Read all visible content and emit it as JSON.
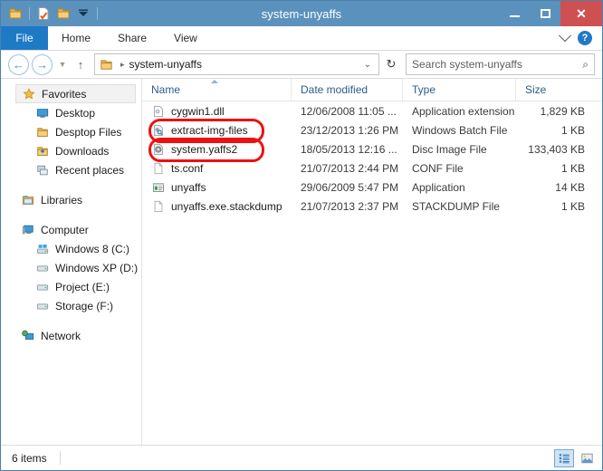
{
  "window": {
    "title": "system-unyaffs",
    "minimize_label": "–",
    "maximize_label": "☐",
    "close_label": "✕"
  },
  "quick_access": [
    {
      "name": "folder-icon",
      "label": "Folder"
    },
    {
      "name": "properties-icon",
      "label": "Properties"
    },
    {
      "name": "new-folder-icon",
      "label": "New folder"
    },
    {
      "name": "customize-dropdown-icon",
      "label": "Customize Quick Access Toolbar"
    }
  ],
  "ribbon": {
    "file_tab": "File",
    "tabs": [
      "Home",
      "Share",
      "View"
    ],
    "expand_label": "⌄",
    "help_label": "?"
  },
  "address": {
    "back_label": "←",
    "forward_label": "→",
    "recent_label": "▼",
    "up_label": "↑",
    "crumb_arrow": "▸",
    "breadcrumb": "system-unyaffs",
    "dropdown_label": "⌄",
    "refresh_label": "↻",
    "search_placeholder": "Search system-unyaffs",
    "search_value": "",
    "search_icon": "⌕"
  },
  "sidebar": {
    "groups": [
      {
        "header": {
          "label": "Favorites",
          "icon": "star-icon",
          "selected": true
        },
        "items": [
          {
            "label": "Desktop",
            "icon": "desktop-icon"
          },
          {
            "label": "Desptop Files",
            "icon": "folder-icon"
          },
          {
            "label": "Downloads",
            "icon": "downloads-icon"
          },
          {
            "label": "Recent places",
            "icon": "recent-places-icon"
          }
        ]
      },
      {
        "header": {
          "label": "Libraries",
          "icon": "libraries-icon",
          "selected": false
        },
        "items": []
      },
      {
        "header": {
          "label": "Computer",
          "icon": "computer-icon",
          "selected": false
        },
        "items": [
          {
            "label": "Windows 8 (C:)",
            "icon": "windows-drive-icon"
          },
          {
            "label": "Windows XP (D:)",
            "icon": "drive-icon"
          },
          {
            "label": "Project (E:)",
            "icon": "drive-icon"
          },
          {
            "label": "Storage (F:)",
            "icon": "drive-icon"
          }
        ]
      },
      {
        "header": {
          "label": "Network",
          "icon": "network-icon",
          "selected": false
        },
        "items": []
      }
    ]
  },
  "filelist": {
    "columns": [
      "Name",
      "Date modified",
      "Type",
      "Size"
    ],
    "sort_column": "Name",
    "sort_direction": "ascending",
    "rows": [
      {
        "name": "cygwin1.dll",
        "date": "12/06/2008 11:05 ...",
        "type": "Application extension",
        "size": "1,829 KB",
        "icon": "dll-file-icon",
        "annotated": false
      },
      {
        "name": "extract-img-files",
        "date": "23/12/2013 1:26 PM",
        "type": "Windows Batch File",
        "size": "1 KB",
        "icon": "batch-file-icon",
        "annotated": true
      },
      {
        "name": "system.yaffs2",
        "date": "18/05/2013 12:16 ...",
        "type": "Disc Image File",
        "size": "133,403 KB",
        "icon": "disc-image-icon",
        "annotated": true
      },
      {
        "name": "ts.conf",
        "date": "21/07/2013 2:44 PM",
        "type": "CONF File",
        "size": "1 KB",
        "icon": "generic-file-icon",
        "annotated": false
      },
      {
        "name": "unyaffs",
        "date": "29/06/2009 5:47 PM",
        "type": "Application",
        "size": "14 KB",
        "icon": "application-icon",
        "annotated": false
      },
      {
        "name": "unyaffs.exe.stackdump",
        "date": "21/07/2013 2:37 PM",
        "type": "STACKDUMP File",
        "size": "1 KB",
        "icon": "generic-file-icon",
        "annotated": false
      }
    ]
  },
  "statusbar": {
    "item_count": "6 items",
    "details_view_label": "Details view",
    "large_icons_view_label": "Large icons view",
    "selected_view": "details"
  },
  "colors": {
    "titlebar": "#5b92bd",
    "file_tab": "#1f7ac6",
    "close_button": "#cf5050",
    "annotation": "#ee1111",
    "header_text": "#2d5c88"
  }
}
